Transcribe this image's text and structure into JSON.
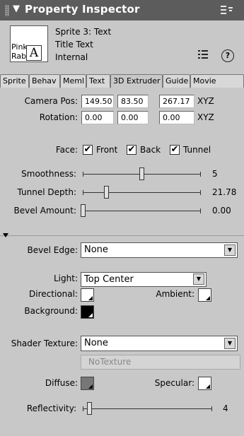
{
  "window": {
    "title": "Property Inspector"
  },
  "sprite": {
    "name": "Sprite 3: Text",
    "type": "Title Text",
    "location": "Internal",
    "thumb_line1": "Pink",
    "thumb_line2": "Rabb",
    "thumb_glyph": "A"
  },
  "tabs": [
    {
      "label": "Sprite"
    },
    {
      "label": "Behav"
    },
    {
      "label": "Meml"
    },
    {
      "label": "Text"
    },
    {
      "label": "3D Extruder",
      "active": true
    },
    {
      "label": "Guide"
    },
    {
      "label": "Movie"
    }
  ],
  "camera": {
    "pos_label": "Camera Pos:",
    "pos": [
      "149.50",
      "83.50",
      "267.17"
    ],
    "rot_label": "Rotation:",
    "rot": [
      "0.00",
      "0.00",
      "0.00"
    ],
    "unit": "XYZ"
  },
  "face": {
    "label": "Face:",
    "front": {
      "label": "Front",
      "checked": true
    },
    "back": {
      "label": "Back",
      "checked": true
    },
    "tunnel": {
      "label": "Tunnel",
      "checked": true
    }
  },
  "sliders": {
    "smoothness": {
      "label": "Smoothness:",
      "value": "5",
      "fraction": 0.5
    },
    "tunnel_depth": {
      "label": "Tunnel Depth:",
      "value": "21.78",
      "fraction": 0.2
    },
    "bevel_amount": {
      "label": "Bevel Amount:",
      "value": "0.00",
      "fraction": 0.0
    },
    "reflectivity": {
      "label": "Reflectivity:",
      "value": "4",
      "fraction": 0.04
    }
  },
  "bevel_edge": {
    "label": "Bevel Edge:",
    "value": "None"
  },
  "light": {
    "label": "Light:",
    "value": "Top Center"
  },
  "directional": {
    "label": "Directional:"
  },
  "ambient": {
    "label": "Ambient:"
  },
  "background": {
    "label": "Background:"
  },
  "shader": {
    "label": "Shader Texture:",
    "value": "None",
    "texture_field": "NoTexture"
  },
  "diffuse": {
    "label": "Diffuse:"
  },
  "specular": {
    "label": "Specular:"
  },
  "icons": {
    "title_arrow": "disclosure-triangle",
    "menu": "panel-menu-icon",
    "list": "list-view-icon",
    "help": "help-icon",
    "checkmark": "✔"
  }
}
